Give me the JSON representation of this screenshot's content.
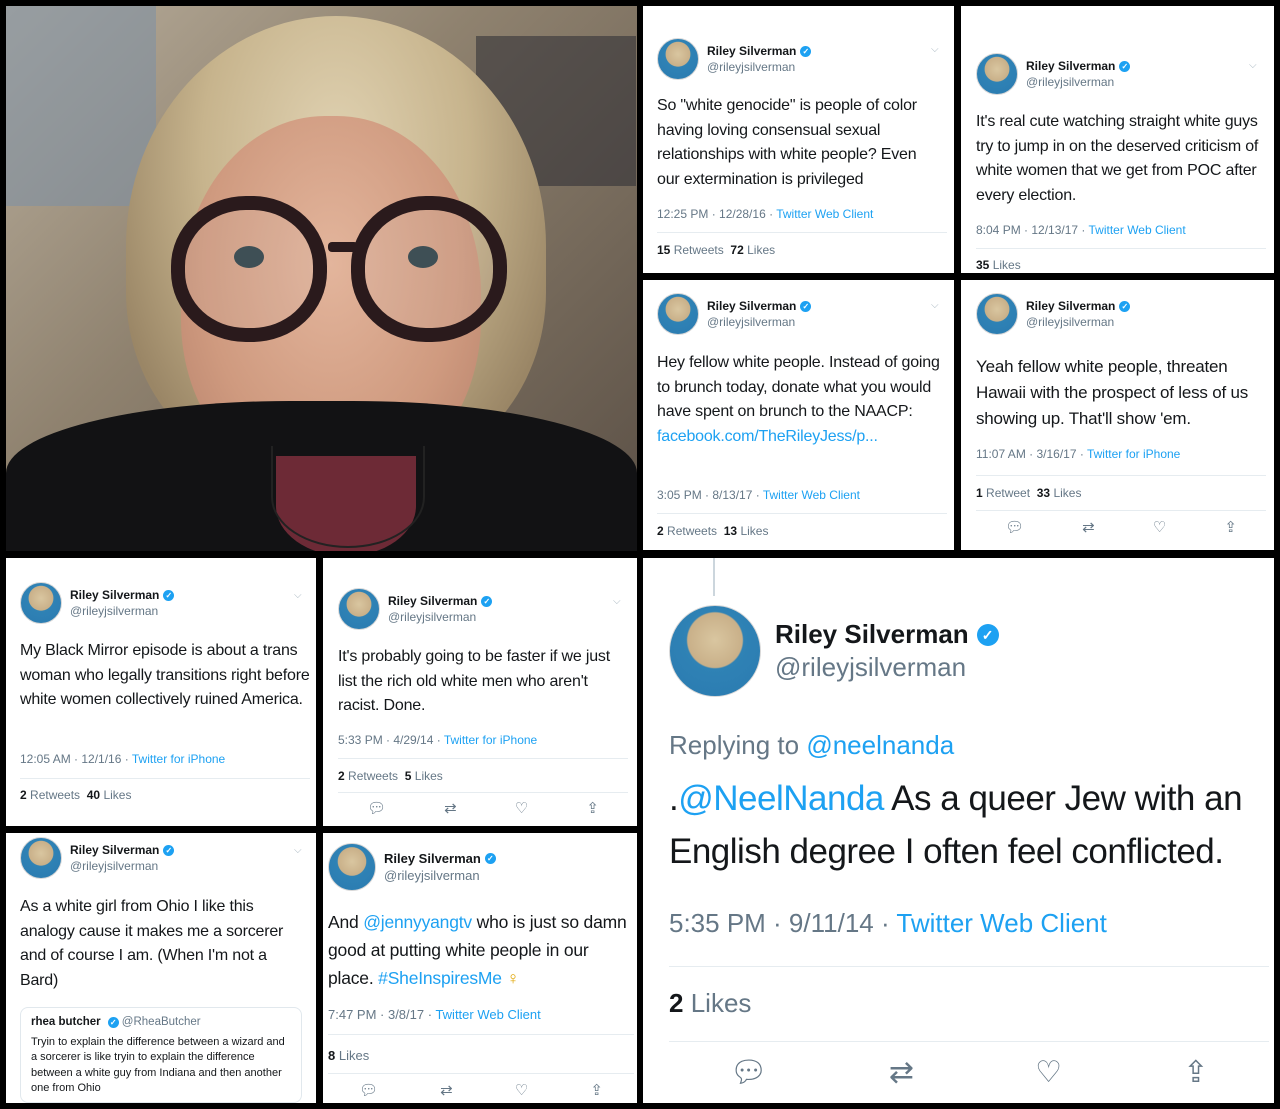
{
  "author": {
    "name": "Riley Silverman",
    "handle": "@rileyjsilverman"
  },
  "icons": {
    "verified": "verified-check-icon",
    "chevron": "chevron-down-icon",
    "reply": "reply-icon",
    "retweet": "retweet-icon",
    "like": "heart-icon",
    "share": "share-icon"
  },
  "colors": {
    "link": "#1da1f2",
    "meta": "#657786",
    "text": "#14171a"
  },
  "tweets": [
    {
      "text": "So \"white genocide\" is people of color having loving consensual sexual relationships with white people? Even our extermination is privileged",
      "time": "12:25 PM · 12/28/16 · ",
      "source": "Twitter Web Client",
      "retweets": "15",
      "retweets_label": "Retweets",
      "likes": "72",
      "likes_label": "Likes"
    },
    {
      "text": "It's real cute watching straight white guys try to jump in on the deserved criticism of white women that we get from POC after every election.",
      "time": "8:04 PM · 12/13/17 · ",
      "source": "Twitter Web Client",
      "likes": "35",
      "likes_label": "Likes"
    },
    {
      "text": "Hey fellow white people. Instead of going to brunch today, donate what you would have spent on brunch to the NAACP: ",
      "link": "facebook.com/TheRileyJess/p...",
      "time": "3:05 PM · 8/13/17 · ",
      "source": "Twitter Web Client",
      "retweets": "2",
      "retweets_label": "Retweets",
      "likes": "13",
      "likes_label": "Likes"
    },
    {
      "text": "Yeah fellow white people, threaten Hawaii with the prospect of less of us showing up. That'll show 'em.",
      "time": "11:07 AM · 3/16/17 · ",
      "source": "Twitter for iPhone",
      "retweets": "1",
      "retweets_label": "Retweet",
      "likes": "33",
      "likes_label": "Likes"
    },
    {
      "text": "My Black Mirror episode is about a trans woman who legally transitions right before white women collectively ruined America.",
      "time": "12:05 AM · 12/1/16 · ",
      "source": "Twitter for iPhone",
      "retweets": "2",
      "retweets_label": "Retweets",
      "likes": "40",
      "likes_label": "Likes"
    },
    {
      "text": "It's probably going to be faster if we just list the rich old white men who aren't racist. Done.",
      "time": "5:33 PM · 4/29/14 · ",
      "source": "Twitter for iPhone",
      "retweets": "2",
      "retweets_label": "Retweets",
      "likes": "5",
      "likes_label": "Likes"
    },
    {
      "text": "As a white girl from Ohio I like this analogy cause it makes me a sorcerer and of course I am. (When I'm not a Bard)",
      "quote": {
        "name": "rhea butcher",
        "handle": "@RheaButcher",
        "text": "Tryin to explain the difference between a wizard and a sorcerer is like tryin to explain the difference between a white guy from Indiana and then another one from Ohio"
      }
    },
    {
      "text_pre": "And ",
      "mention": "@jennyyangtv",
      "text_mid": " who is just so damn good at putting white people in our place. ",
      "hashtag": "#SheInspiresMe",
      "emoji": "♀",
      "time": "7:47 PM · 3/8/17 · ",
      "source": "Twitter Web Client",
      "likes": "8",
      "likes_label": "Likes"
    },
    {
      "replying_label": "Replying to ",
      "replying_to": "@neelnanda",
      "text_pre": ".",
      "mention": "@NeelNanda",
      "text_mid": " As a queer Jew with an English degree I often feel conflicted.",
      "time": "5:35 PM · 9/11/14 · ",
      "source": "Twitter Web Client",
      "likes": "2",
      "likes_label": "Likes"
    }
  ]
}
